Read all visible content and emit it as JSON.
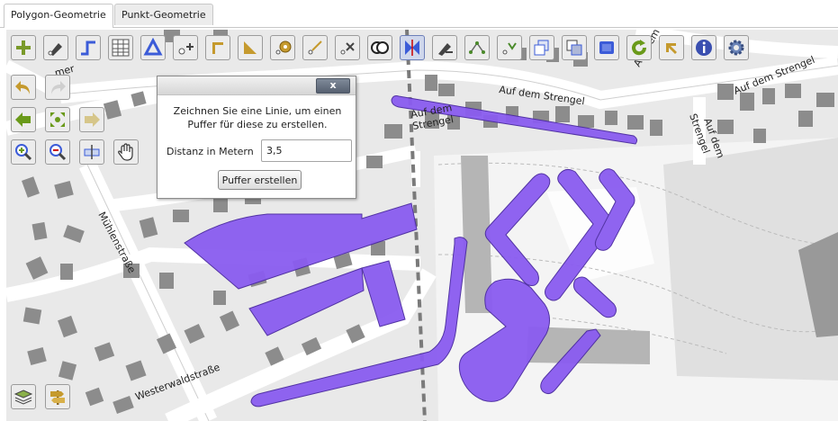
{
  "tabs": [
    {
      "label": "Polygon-Geometrie",
      "active": true
    },
    {
      "label": "Punkt-Geometrie",
      "active": false
    }
  ],
  "toolbar": {
    "tools": [
      {
        "id": "add-point",
        "icon": "add-point-icon"
      },
      {
        "id": "draw-freehand",
        "icon": "pen-icon"
      },
      {
        "id": "draw-line",
        "icon": "line-icon"
      },
      {
        "id": "attribute-table",
        "icon": "table-icon"
      },
      {
        "id": "draw-polygon",
        "icon": "polygon-icon"
      },
      {
        "id": "move-vertex",
        "icon": "move-vertex-icon"
      },
      {
        "id": "right-angle",
        "icon": "right-angle-icon"
      },
      {
        "id": "angle-tool",
        "icon": "triangle-ruler-icon"
      },
      {
        "id": "buffer-point",
        "icon": "buffer-icon"
      },
      {
        "id": "parallel-line",
        "icon": "parallel-icon"
      },
      {
        "id": "cut-line",
        "icon": "cut-icon"
      },
      {
        "id": "union",
        "icon": "union-icon"
      },
      {
        "id": "split-polygon",
        "icon": "split-icon"
      },
      {
        "id": "delete-part",
        "icon": "delete-part-icon"
      },
      {
        "id": "edit-vertices",
        "icon": "vertices-icon"
      },
      {
        "id": "merge-vertices",
        "icon": "merge-icon"
      },
      {
        "id": "copy-geometry",
        "icon": "copy-icon"
      },
      {
        "id": "overlay",
        "icon": "overlay-icon"
      },
      {
        "id": "select-rectangle",
        "icon": "rectangle-icon"
      },
      {
        "id": "refresh",
        "icon": "refresh-icon"
      },
      {
        "id": "back-arrow",
        "icon": "back-arrow-icon"
      },
      {
        "id": "info",
        "icon": "info-icon"
      },
      {
        "id": "settings",
        "icon": "gear-icon"
      }
    ],
    "nav_tools": [
      {
        "id": "undo",
        "icon": "undo-icon"
      },
      {
        "id": "redo",
        "icon": "redo-icon"
      },
      {
        "id": "previous-extent",
        "icon": "arrow-left-icon"
      },
      {
        "id": "full-extent",
        "icon": "full-extent-icon"
      },
      {
        "id": "next-extent",
        "icon": "arrow-right-icon"
      },
      {
        "id": "zoom-in",
        "icon": "zoom-in-icon"
      },
      {
        "id": "zoom-out",
        "icon": "zoom-out-icon"
      },
      {
        "id": "measure",
        "icon": "measure-icon"
      },
      {
        "id": "pan",
        "icon": "hand-icon"
      }
    ],
    "bottom_tools": [
      {
        "id": "layers",
        "icon": "layers-icon"
      },
      {
        "id": "signpost",
        "icon": "signpost-icon"
      }
    ]
  },
  "dialog": {
    "close_label": "x",
    "message": "Zeichnen Sie eine Linie, um einen Puffer für diese zu erstellen.",
    "distance_label": "Distanz in Metern",
    "distance_value": "3,5",
    "submit_label": "Puffer erstellen"
  },
  "map": {
    "street_labels": [
      "Auf dem Strengel",
      "Auf dem Strengel",
      "Auf dem Strengel",
      "Auf dem",
      "Strengel",
      "Auf dem",
      "Strengel",
      "Mühlenstraße",
      "Westerwaldstraße",
      "mer"
    ]
  },
  "colors": {
    "polygon_fill": "#8a5cf0",
    "polygon_stroke": "#4a2aa0",
    "map_background": "#e9e9e9",
    "building": "#8c8c8c",
    "road": "#ffffff"
  }
}
